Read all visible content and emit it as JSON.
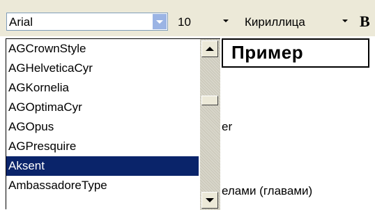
{
  "toolbar": {
    "font_name": "Arial",
    "font_size": "10",
    "charset": "Кириллица",
    "bold_label": "B"
  },
  "preview": {
    "sample_text": "Пример"
  },
  "font_list": {
    "items": [
      "AGCrownStyle",
      "AGHelveticaCyr",
      "AGKornelia",
      "AGOptimaCyr",
      "AGOpus",
      "AGPresquire",
      "Aksent",
      "AmbassadoreType"
    ],
    "selected": "Aksent"
  },
  "document": {
    "fragment_1": "er",
    "fragment_2": "елами (главами)"
  },
  "colors": {
    "selection": "#0a246a",
    "toolbar_bg": "#ece9d8",
    "combo_button": "#9bb4e4"
  }
}
